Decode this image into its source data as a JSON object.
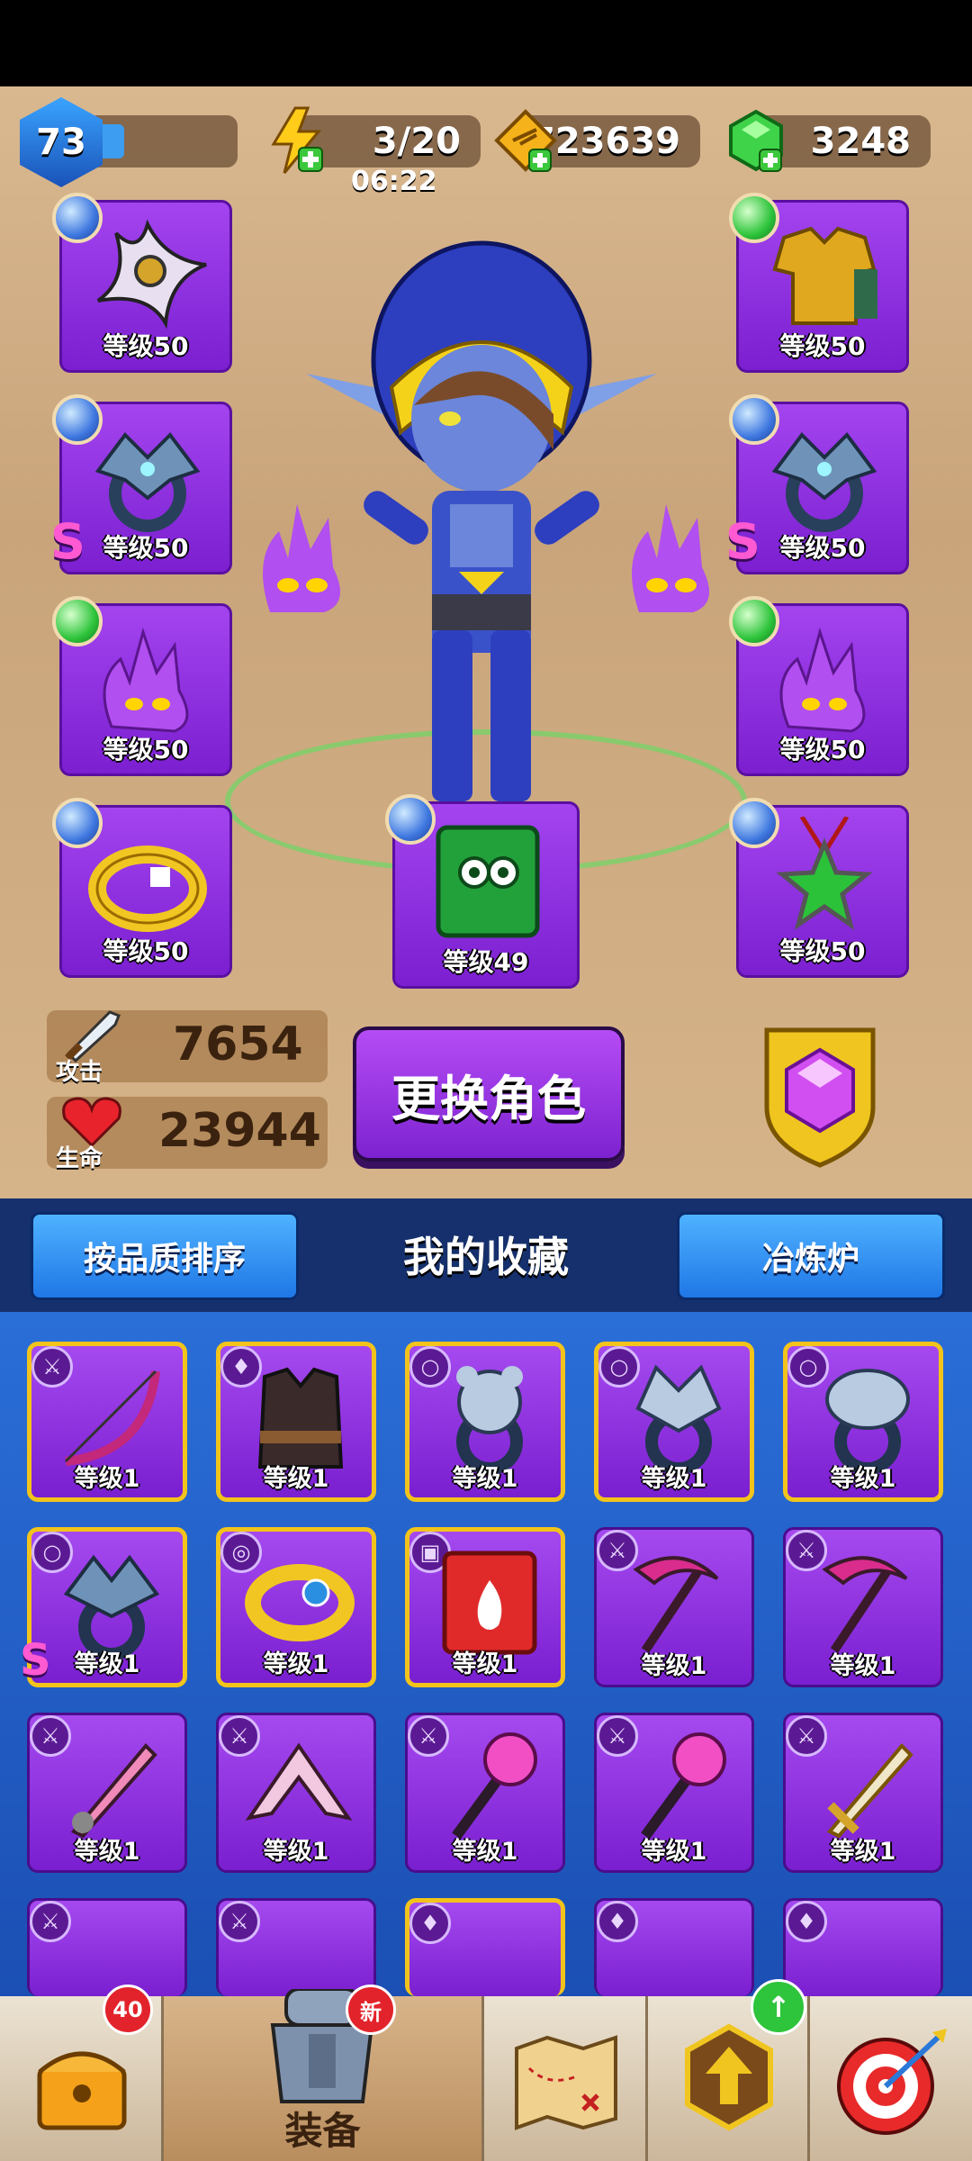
{
  "header": {
    "player_level": "73",
    "xp_fraction": 0.25,
    "energy": "3/20",
    "energy_timer": "06:22",
    "coins": "723639",
    "gems": "3248"
  },
  "equipment": {
    "slot_weapon_label": "等级50",
    "slot_armor_label": "等级50",
    "slot_ring1_label": "等级50",
    "slot_ring2_label": "等级50",
    "slot_pet1_label": "等级50",
    "slot_pet2_label": "等级50",
    "slot_bracelet_label": "等级50",
    "slot_book_label": "等级49",
    "slot_amulet_label": "等级50",
    "s_badge": "S"
  },
  "stats": {
    "attack_label": "攻击",
    "attack_value": "7654",
    "hp_label": "生命",
    "hp_value": "23944"
  },
  "change_hero_label": "更换角色",
  "collection_bar": {
    "sort_label": "按品质排序",
    "title": "我的收藏",
    "smelter_label": "冶炼炉"
  },
  "items": [
    {
      "label": "等级1"
    },
    {
      "label": "等级1"
    },
    {
      "label": "等级1"
    },
    {
      "label": "等级1"
    },
    {
      "label": "等级1"
    },
    {
      "label": "等级1"
    },
    {
      "label": "等级1"
    },
    {
      "label": "等级1"
    },
    {
      "label": "等级1"
    },
    {
      "label": "等级1"
    },
    {
      "label": "等级1"
    },
    {
      "label": "等级1"
    },
    {
      "label": "等级1"
    },
    {
      "label": "等级1"
    },
    {
      "label": "等级1"
    }
  ],
  "nav": {
    "chest_badge": "40",
    "equip_badge": "新",
    "equip_label": "装备"
  }
}
